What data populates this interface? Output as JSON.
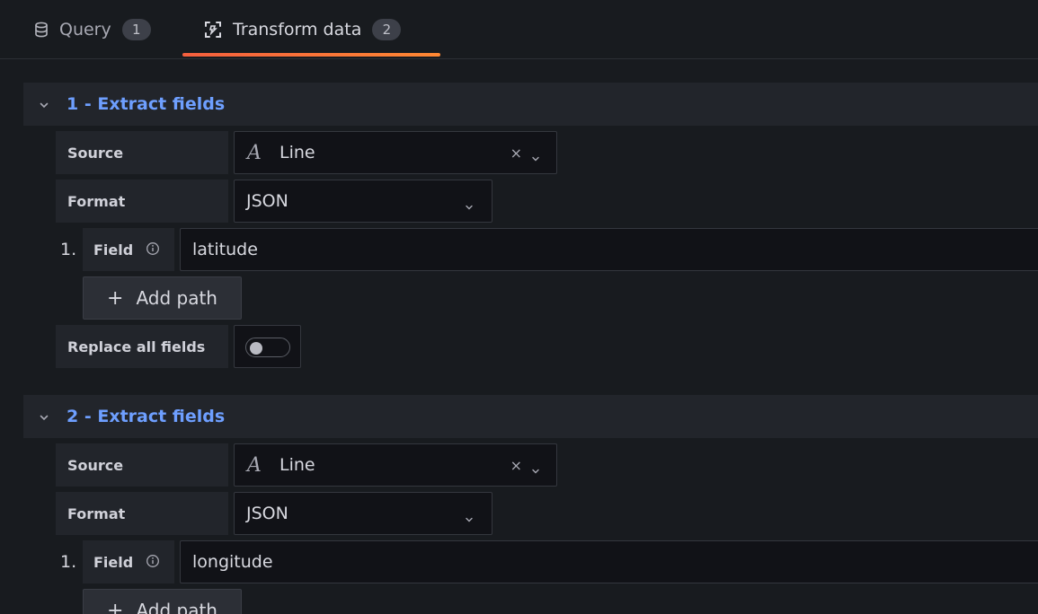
{
  "tabs": [
    {
      "label": "Query",
      "count": "1",
      "icon": "database-icon",
      "active": false
    },
    {
      "label": "Transform data",
      "count": "2",
      "icon": "transform-icon",
      "active": true
    }
  ],
  "transformations": [
    {
      "title": "1 - Extract fields",
      "source_label": "Source",
      "source_icon": "text-field-icon",
      "source_icon_glyph": "A",
      "source_value": "Line",
      "clear_glyph": "×",
      "format_label": "Format",
      "format_value": "JSON",
      "paths": [
        {
          "index": "1.",
          "label": "Field",
          "value": "latitude"
        }
      ],
      "add_path_label": "Add path",
      "add_path_glyph": "+",
      "replace_label": "Replace all fields",
      "replace_value": false
    },
    {
      "title": "2 - Extract fields",
      "source_label": "Source",
      "source_icon": "text-field-icon",
      "source_icon_glyph": "A",
      "source_value": "Line",
      "clear_glyph": "×",
      "format_label": "Format",
      "format_value": "JSON",
      "paths": [
        {
          "index": "1.",
          "label": "Field",
          "value": "longitude"
        }
      ],
      "add_path_label": "Add path",
      "add_path_glyph": "+"
    }
  ],
  "colors": {
    "background": "#181b1f",
    "panel": "#22252b",
    "input_bg": "#111217",
    "accent_title": "#6e9fff",
    "tab_underline": "#ff7a3d"
  }
}
